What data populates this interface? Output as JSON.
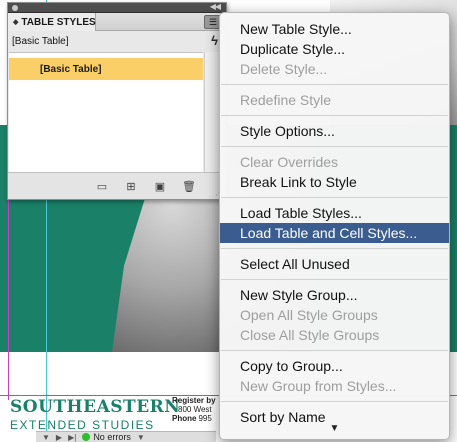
{
  "panel": {
    "tab_label": "TABLE STYLES",
    "current_style": "[Basic Table]",
    "list": [
      "[Basic Table]"
    ],
    "footer_icons": [
      "folder-icon",
      "new-from-styles-icon",
      "new-style-icon",
      "trash-icon"
    ]
  },
  "menu": {
    "groups": [
      [
        {
          "label": "New Table Style...",
          "enabled": true
        },
        {
          "label": "Duplicate Style...",
          "enabled": true
        },
        {
          "label": "Delete Style...",
          "enabled": false
        }
      ],
      [
        {
          "label": "Redefine Style",
          "enabled": false
        }
      ],
      [
        {
          "label": "Style Options...",
          "enabled": true
        }
      ],
      [
        {
          "label": "Clear Overrides",
          "enabled": false
        },
        {
          "label": "Break Link to Style",
          "enabled": true
        }
      ],
      [
        {
          "label": "Load Table Styles...",
          "enabled": true
        },
        {
          "label": "Load Table and Cell Styles...",
          "enabled": true,
          "highlighted": true
        }
      ],
      [
        {
          "label": "Select All Unused",
          "enabled": true
        }
      ],
      [
        {
          "label": "New Style Group...",
          "enabled": true
        },
        {
          "label": "Open All Style Groups",
          "enabled": false
        },
        {
          "label": "Close All Style Groups",
          "enabled": false
        }
      ],
      [
        {
          "label": "Copy to Group...",
          "enabled": true
        },
        {
          "label": "New Group from Styles...",
          "enabled": false
        }
      ],
      [
        {
          "label": "Sort by Name",
          "enabled": true
        }
      ]
    ],
    "more_arrow": "▼"
  },
  "document": {
    "brand_name": "SOUTHEASTERN",
    "brand_sub": "EXTENDED STUDIES",
    "register_line1": "Register by",
    "register_line2": "800 West",
    "register_phone_label": "Phone",
    "register_phone": "995"
  },
  "statusbar": {
    "errors": "No errors"
  },
  "colors": {
    "teal": "#1a8067",
    "selection": "#fbcf68",
    "menu_highlight": "#3b5c8e"
  }
}
